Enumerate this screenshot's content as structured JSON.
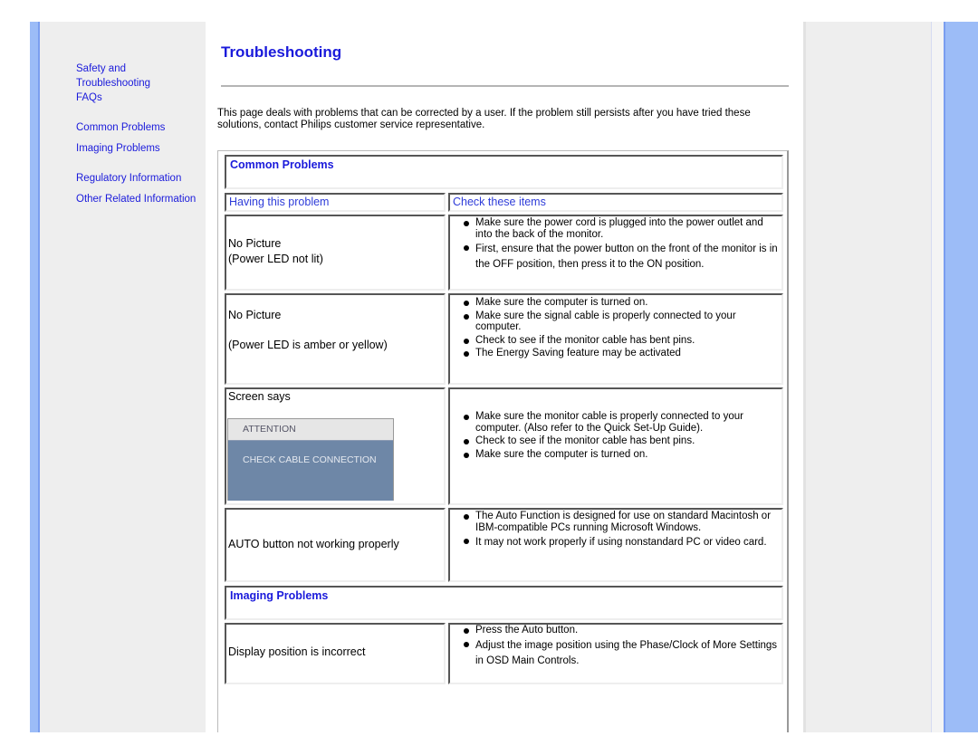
{
  "sidebar": {
    "links": [
      {
        "label": "Safety and"
      },
      {
        "label": "Troubleshooting"
      },
      {
        "label": "FAQs"
      },
      {
        "label": "Common Problems"
      },
      {
        "label": "Imaging Problems"
      },
      {
        "label": "Regulatory Information"
      },
      {
        "label": "Other Related Information"
      }
    ]
  },
  "page": {
    "title": "Troubleshooting",
    "intro": "This page deals with problems that can be corrected by a user. If the problem still persists after you have tried these solutions, contact Philips customer service representative."
  },
  "table": {
    "common_title": "Common Problems",
    "col_problem": "Having this problem",
    "col_check": "Check these items",
    "imaging_title": "Imaging Problems",
    "rows": [
      {
        "problem": [
          "No Picture",
          "(Power LED not lit)"
        ],
        "items": [
          "Make sure the power cord is plugged into the power outlet and into the back of the monitor.",
          "First, ensure that the power button on the front of the monitor is in the OFF position, then press it to the ON position."
        ]
      },
      {
        "problem": [
          "No Picture",
          "(Power LED is amber or yellow)"
        ],
        "items": [
          "Make sure the computer is turned on.",
          "Make sure the signal cable is properly connected to your computer.",
          "Check to see if the monitor cable has bent pins.",
          "The Energy Saving feature may be activated"
        ]
      },
      {
        "problem": [
          "Screen says"
        ],
        "osd_title": "ATTENTION",
        "osd_message": "CHECK CABLE CONNECTION",
        "items": [
          "Make sure the monitor cable is properly connected to your computer. (Also refer to the Quick Set-Up Guide).",
          "Check to see if the monitor cable has bent pins.",
          "Make sure the computer is turned on."
        ]
      },
      {
        "problem": [
          "AUTO button not working properly"
        ],
        "items": [
          "The Auto Function is designed for use on standard Macintosh or IBM-compatible PCs running Microsoft Windows.",
          "It may not work properly if using nonstandard PC or video card."
        ]
      },
      {
        "problem": [
          "Display position is incorrect"
        ],
        "items": [
          "Press the Auto button.",
          "Adjust the image position using the Phase/Clock of More Settings in OSD Main Controls."
        ]
      }
    ]
  },
  "colors": {
    "link": "#1a1adb",
    "accent_strip": "#9cbcf7",
    "sidebar_bg": "#eeeeee",
    "osd_body": "#6e87a7"
  }
}
